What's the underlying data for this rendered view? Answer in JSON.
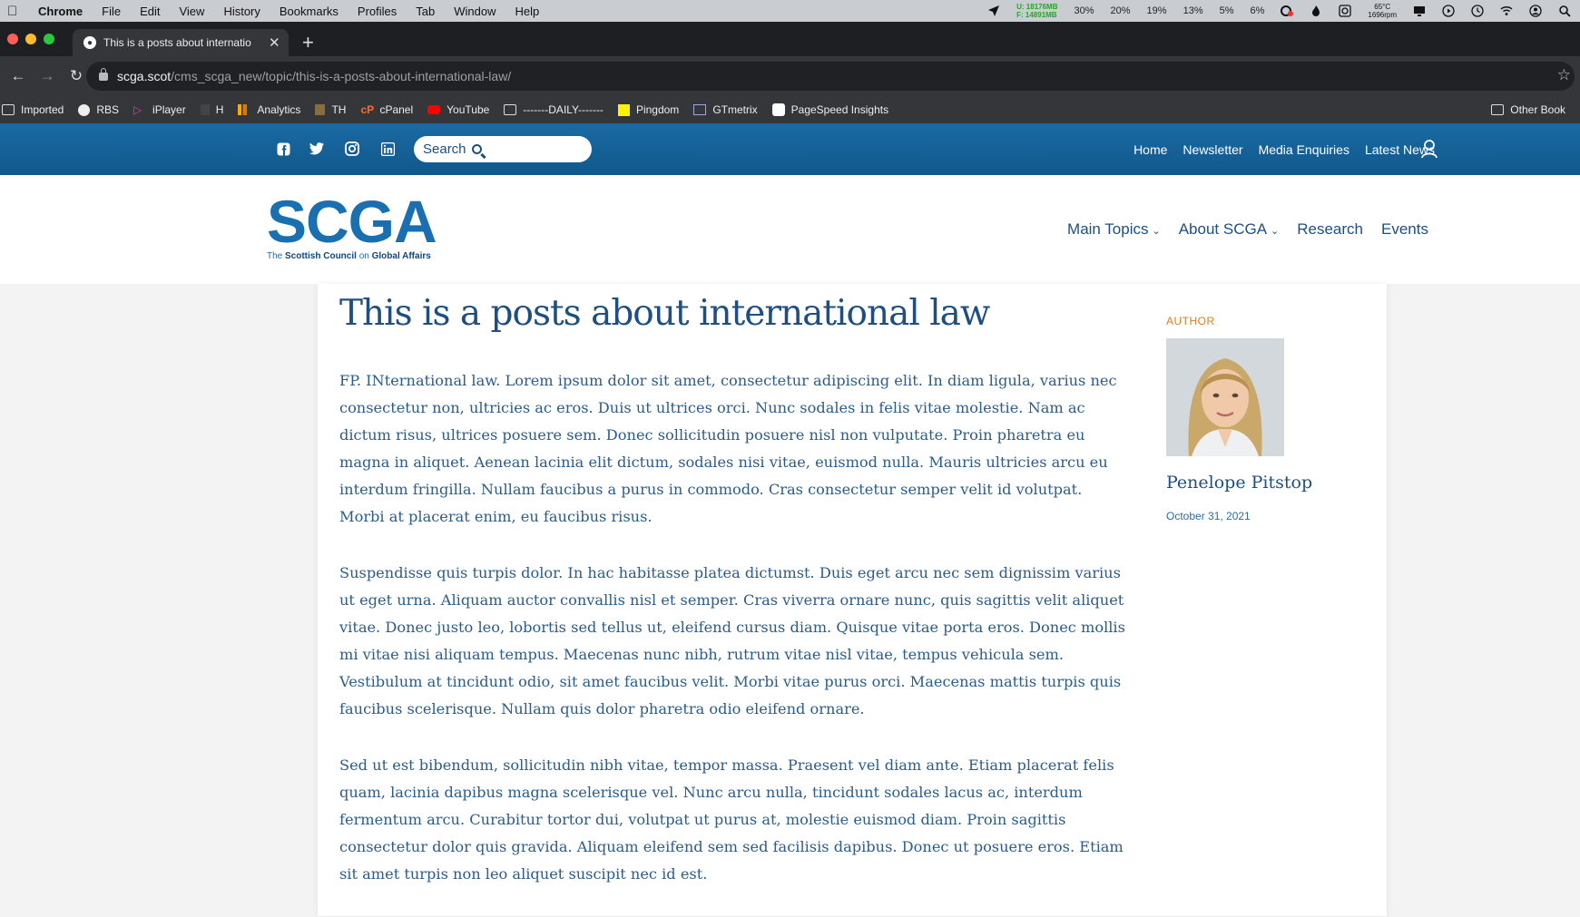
{
  "mac": {
    "menu": [
      "Chrome",
      "File",
      "Edit",
      "View",
      "History",
      "Bookmarks",
      "Profiles",
      "Tab",
      "Window",
      "Help"
    ],
    "mem_u": "U: 18176MB",
    "mem_f": "F: 14891MB",
    "cpu": [
      "30%",
      "20%",
      "19%",
      "13%",
      "5%",
      "6%"
    ],
    "temp": "65°C",
    "rpm": "1696rpm"
  },
  "browser": {
    "tab_title": "This is a posts about internatio",
    "url_host": "scga.scot",
    "url_path": "/cms_scga_new/topic/this-is-a-posts-about-international-law/",
    "bookmarks": [
      "Imported",
      "RBS",
      "iPlayer",
      "H",
      "Analytics",
      "TH",
      "cPanel",
      "YouTube",
      "-------DAILY-------",
      "Pingdom",
      "GTmetrix",
      "PageSpeed Insights"
    ],
    "other_bookmarks": "Other Book"
  },
  "site": {
    "search_label": "Search",
    "top_links": [
      "Home",
      "Newsletter",
      "Media Enquiries",
      "Latest News"
    ],
    "logo_text": "SCGA",
    "logo_tag_pre": "The",
    "logo_tag_b1": "Scottish Council",
    "logo_tag_mid": "on",
    "logo_tag_b2": "Global Affairs",
    "nav": [
      "Main Topics",
      "About SCGA",
      "Research",
      "Events"
    ],
    "colors": {
      "brand": "#1a6fb0",
      "accent": "#e07b1a",
      "text": "#2b5c8a"
    }
  },
  "post": {
    "title": "This is a posts about international law",
    "paragraphs": [
      "FP. INternational law. Lorem ipsum dolor sit amet, consectetur adipiscing elit. In diam ligula, varius nec consectetur non, ultricies ac eros. Duis ut ultrices orci. Nunc sodales in felis vitae molestie. Nam ac dictum risus, ultrices posuere sem. Donec sollicitudin posuere nisl non vulputate. Proin pharetra eu magna in aliquet. Aenean lacinia elit dictum, sodales nisi vitae, euismod nulla. Mauris ultricies arcu eu interdum fringilla. Nullam faucibus a purus in commodo. Cras consectetur semper velit id volutpat. Morbi at placerat enim, eu faucibus risus.",
      "Suspendisse quis turpis dolor. In hac habitasse platea dictumst. Duis eget arcu nec sem dignissim varius ut eget urna. Aliquam auctor convallis nisl et semper. Cras viverra ornare nunc, quis sagittis velit aliquet vitae. Donec justo leo, lobortis sed tellus ut, eleifend cursus diam. Quisque vitae porta eros. Donec mollis mi vitae nisi aliquam tempus. Maecenas nunc nibh, rutrum vitae nisl vitae, tempus vehicula sem. Vestibulum at tincidunt odio, sit amet faucibus velit. Morbi vitae purus orci. Maecenas mattis turpis quis faucibus scelerisque. Nullam quis dolor pharetra odio eleifend ornare.",
      "Sed ut est bibendum, sollicitudin nibh vitae, tempor massa. Praesent vel diam ante. Etiam placerat felis quam, lacinia dapibus magna scelerisque vel. Nunc arcu nulla, tincidunt sodales lacus ac, interdum fermentum arcu. Curabitur tortor dui, volutpat ut purus at, molestie euismod diam. Proin sagittis consectetur dolor quis gravida. Aliquam eleifend sem sed facilisis dapibus. Donec ut posuere eros. Etiam sit amet turpis non leo aliquet suscipit nec id est."
    ],
    "author_label": "AUTHOR",
    "author_name": "Penelope Pitstop",
    "date": "October 31, 2021"
  }
}
